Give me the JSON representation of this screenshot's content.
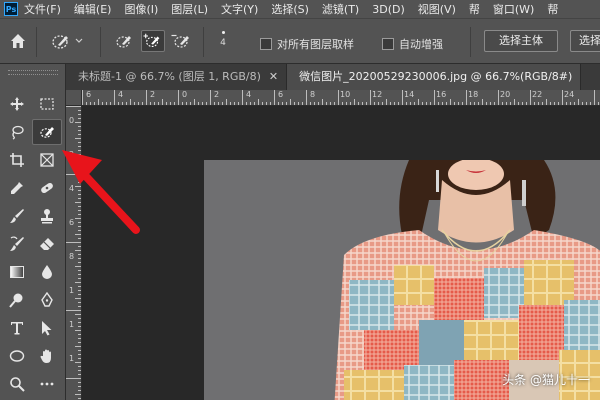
{
  "app": {
    "logo": "Ps"
  },
  "menu": [
    "文件(F)",
    "编辑(E)",
    "图像(I)",
    "图层(L)",
    "文字(Y)",
    "选择(S)",
    "滤镜(T)",
    "3D(D)",
    "视图(V)",
    "帮",
    "窗口(W)",
    "帮"
  ],
  "options_bar": {
    "brush_size": "4",
    "sample_all_layers_label": "对所有图层取样",
    "sample_all_layers_checked": false,
    "auto_enhance_label": "自动增强",
    "auto_enhance_checked": false,
    "select_subject_label": "选择主体",
    "select_and_mask_label": "选择"
  },
  "tabs": [
    {
      "label": "未标题-1 @ 66.7% (图层 1, RGB/8)",
      "active": false
    },
    {
      "label": "微信图片_20200529230006.jpg @ 66.7%(RGB/8#)",
      "active": true
    }
  ],
  "ruler": {
    "h_labels": [
      "6",
      "4",
      "2",
      "0",
      "2",
      "4",
      "6",
      "8",
      "10",
      "12",
      "14",
      "16",
      "18",
      "20",
      "22",
      "24"
    ],
    "v_labels": [
      "0",
      "2",
      "4",
      "6",
      "8",
      "1",
      "1",
      "1"
    ]
  },
  "active_tool": "quick-selection-tool",
  "colors": {
    "annotation_arrow": "#e8141b",
    "panel": "#535353",
    "workspace": "#282828"
  },
  "watermark": "头条 @猫儿十一"
}
